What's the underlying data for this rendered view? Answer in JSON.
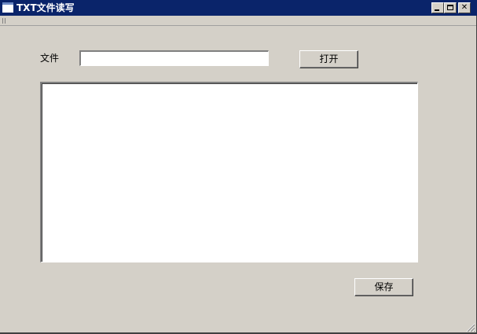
{
  "window": {
    "title": "TXT文件读写",
    "controls": {
      "minimize": "minimize-icon",
      "maximize": "maximize-icon",
      "close": "close-icon",
      "close_glyph": "✕"
    }
  },
  "form": {
    "file_label": "文件",
    "file_input_value": "",
    "open_button_label": "打开",
    "content_value": "",
    "save_button_label": "保存"
  },
  "colors": {
    "titlebar": "#0a246a",
    "window_bg": "#d4d0c8",
    "field_bg": "#ffffff"
  }
}
